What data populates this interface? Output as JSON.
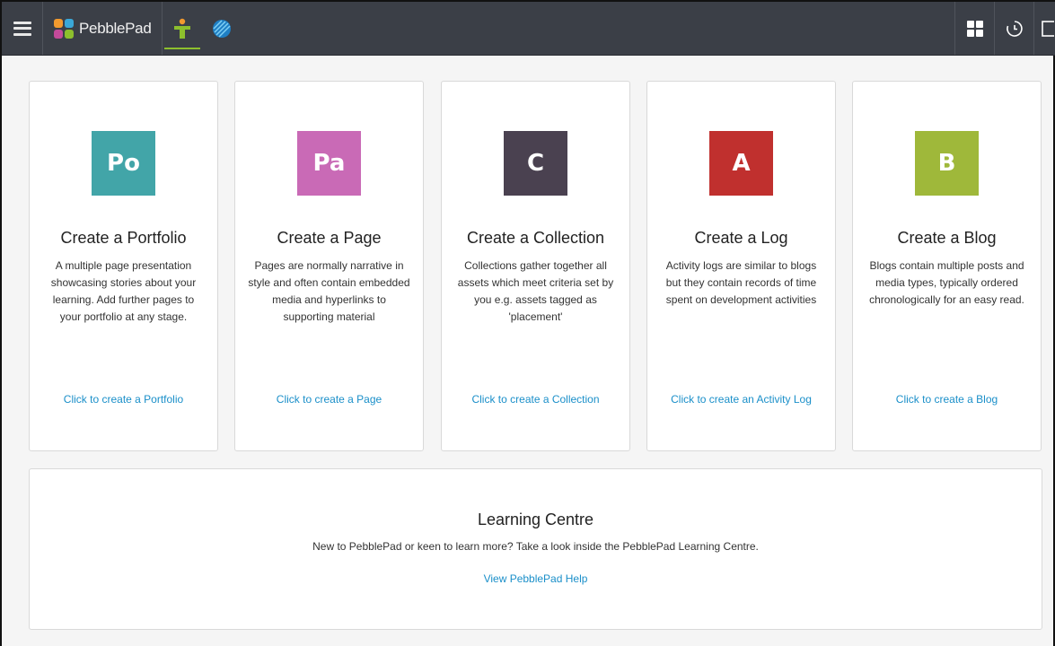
{
  "topbar": {
    "brand": "PebblePad",
    "icons": [
      "menu-icon",
      "pebblepad-logo",
      "person-icon",
      "globe-icon",
      "dashboard-grid-icon",
      "history-icon"
    ]
  },
  "cards": [
    {
      "tile": "Po",
      "color": "#42a5a8",
      "title": "Create a Portfolio",
      "desc": "A multiple page presentation showcasing stories about your learning. Add further pages to your portfolio at any stage.",
      "link": "Click to create a Portfolio"
    },
    {
      "tile": "Pa",
      "color": "#c96ab6",
      "title": "Create a Page",
      "desc": "Pages are normally narrative in style and often contain embedded media and hyperlinks to supporting material",
      "link": "Click to create a Page"
    },
    {
      "tile": "C",
      "color": "#4a4150",
      "title": "Create a Collection",
      "desc": "Collections gather together all assets which meet criteria set by you e.g. assets tagged as 'placement'",
      "link": "Click to create a Collection"
    },
    {
      "tile": "A",
      "color": "#c0302e",
      "title": "Create a Log",
      "desc": "Activity logs are similar to blogs but they contain records of time spent on development activities",
      "link": "Click to create an Activity Log"
    },
    {
      "tile": "B",
      "color": "#9fb83a",
      "title": "Create a Blog",
      "desc": "Blogs contain multiple posts and media types, typically ordered chronologically for an easy read.",
      "link": "Click to create a Blog"
    }
  ],
  "learning": {
    "title": "Learning Centre",
    "desc": "New to PebblePad or keen to learn more? Take a look inside the PebblePad Learning Centre.",
    "link": "View PebblePad Help"
  }
}
